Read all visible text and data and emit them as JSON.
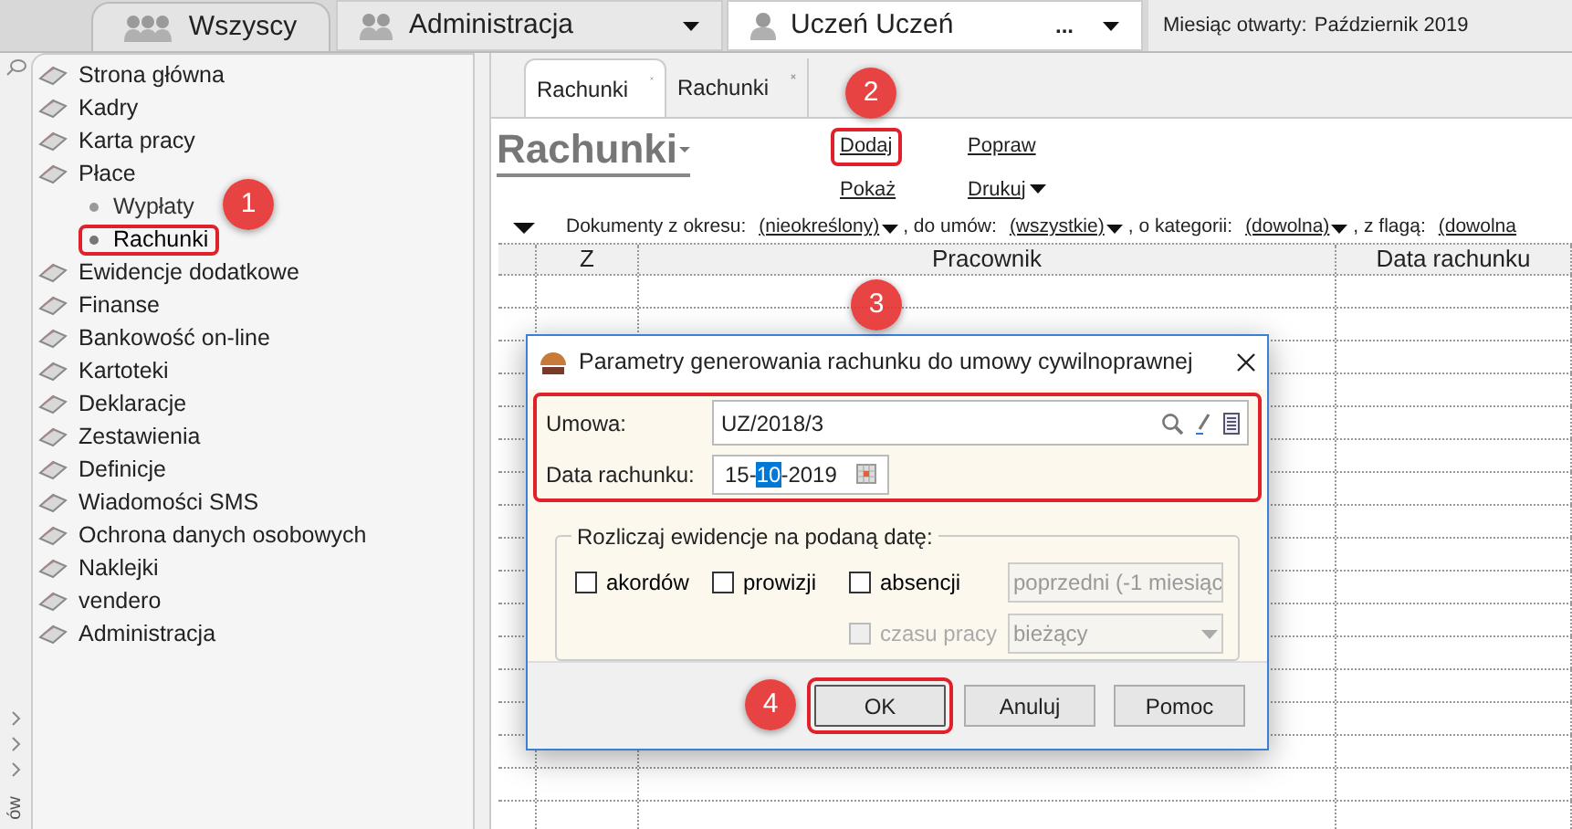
{
  "top_bar": {
    "group_tab": "Wszyscy",
    "department": "Administracja",
    "employee": "Uczeń Uczeń",
    "employee_more": "...",
    "month_label": "Miesiąc otwarty:",
    "month_value": "Październik 2019"
  },
  "sidebar": {
    "items": [
      {
        "label": "Strona główna"
      },
      {
        "label": "Kadry"
      },
      {
        "label": "Karta pracy"
      },
      {
        "label": "Płace",
        "children": [
          {
            "label": "Wypłaty",
            "selected": false,
            "highlighted": false
          },
          {
            "label": "Rachunki",
            "selected": true,
            "highlighted": true
          }
        ]
      },
      {
        "label": "Ewidencje dodatkowe"
      },
      {
        "label": "Finanse"
      },
      {
        "label": "Bankowość on-line"
      },
      {
        "label": "Kartoteki"
      },
      {
        "label": "Deklaracje"
      },
      {
        "label": "Zestawienia"
      },
      {
        "label": "Definicje"
      },
      {
        "label": "Wiadomości SMS"
      },
      {
        "label": "Ochrona danych osobowych"
      },
      {
        "label": "Naklejki"
      },
      {
        "label": "vendero"
      },
      {
        "label": "Administracja"
      }
    ],
    "footer_text": "ów"
  },
  "tabs": [
    {
      "label": "Rachunki",
      "selected": true
    },
    {
      "label": "Rachunki",
      "selected": false
    }
  ],
  "page_title": "Rachunki",
  "actions": [
    {
      "label": "Dodaj",
      "dropdown": false,
      "highlighted": true
    },
    {
      "label": "Popraw",
      "dropdown": false,
      "highlighted": false
    },
    {
      "label": "Pokaż",
      "dropdown": false,
      "highlighted": false
    },
    {
      "label": "Drukuj",
      "dropdown": true,
      "highlighted": false
    }
  ],
  "filters": [
    {
      "label": "Dokumenty z okresu:",
      "value": "(nieokreślony)"
    },
    {
      "label": ", do umów:",
      "value": "(wszystkie)"
    },
    {
      "label": ", o kategorii:",
      "value": "(dowolna)"
    },
    {
      "label": ", z flagą:",
      "value": "(dowolna"
    }
  ],
  "table": {
    "columns": [
      "Z",
      "Pracownik",
      "Data rachunku"
    ]
  },
  "dialog": {
    "title": "Parametry generowania rachunku do umowy cywilnoprawnej",
    "fields_highlighted": true,
    "contract_label": "Umowa:",
    "contract_value": "UZ/2018/3",
    "date_label": "Data rachunku:",
    "date_parts": [
      "15-",
      "10",
      "-2019"
    ],
    "group_title": "Rozliczaj ewidencje na podaną datę:",
    "checkboxes": [
      {
        "label": "akordów",
        "checked": false,
        "disabled": false
      },
      {
        "label": "prowizji",
        "checked": false,
        "disabled": false
      },
      {
        "label": "absencji",
        "checked": false,
        "disabled": false
      },
      {
        "label": "czasu pracy",
        "checked": false,
        "disabled": true
      }
    ],
    "selects": [
      {
        "value": "poprzedni (-1 miesiąc",
        "disabled": true
      },
      {
        "value": "bieżący",
        "disabled": true
      }
    ],
    "buttons": [
      {
        "label": "OK",
        "highlighted": true
      },
      {
        "label": "Anuluj",
        "highlighted": false
      },
      {
        "label": "Pomoc",
        "highlighted": false
      }
    ]
  },
  "callouts": [
    "1",
    "2",
    "3",
    "4"
  ]
}
